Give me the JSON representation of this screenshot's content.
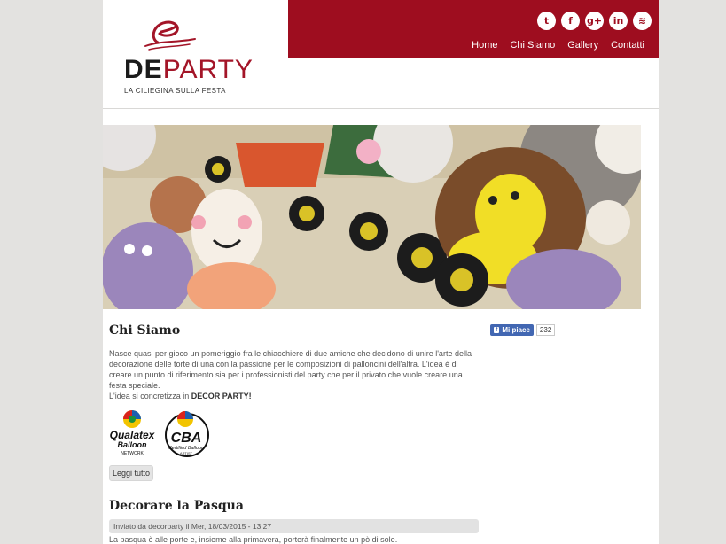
{
  "brand": {
    "de": "DE",
    "party": "PARTY",
    "tagline": "LA CILIEGINA SULLA FESTA"
  },
  "social": [
    {
      "icon": "twitter-icon",
      "glyph": "t"
    },
    {
      "icon": "facebook-icon",
      "glyph": "f"
    },
    {
      "icon": "google-plus-icon",
      "glyph": "g+"
    },
    {
      "icon": "linkedin-icon",
      "glyph": "in"
    },
    {
      "icon": "rss-icon",
      "glyph": "≋"
    }
  ],
  "nav": [
    "Home",
    "Chi Siamo",
    "Gallery",
    "Contatti"
  ],
  "about": {
    "title": "Chi Siamo",
    "body": "Nasce quasi per gioco un pomeriggio fra le chiacchiere di due amiche che decidono di unire l'arte della decorazione delle torte di una con la passione per le composizioni di palloncini dell'altra. L'idea è di creare un punto di riferimento sia per i professionisti del party che per il privato che vuole creare una festa speciale.",
    "line_prefix": "L'idea si concretizza in ",
    "line_bold": "DECOR PARTY!",
    "badge1_word": "Qualatex",
    "badge1_sub": "Balloon",
    "badge1_net": "NETWORK",
    "badge2_word": "CBA",
    "badge2_sub": "Certified Balloon",
    "badge2_art": "ARTIST",
    "read_more": "Leggi tutto"
  },
  "facebook": {
    "label": "Mi piace",
    "count": "232"
  },
  "post": {
    "title": "Decorare la Pasqua",
    "meta": "Inviato da decorparty il Mer, 18/03/2015 - 13:27",
    "excerpt": "La pasqua è alle porte e, insieme alla primavera, porterà finalmente un pò di sole."
  },
  "colors": {
    "brand_red": "#9e0d1f",
    "page_bg": "#e3e2e0"
  }
}
